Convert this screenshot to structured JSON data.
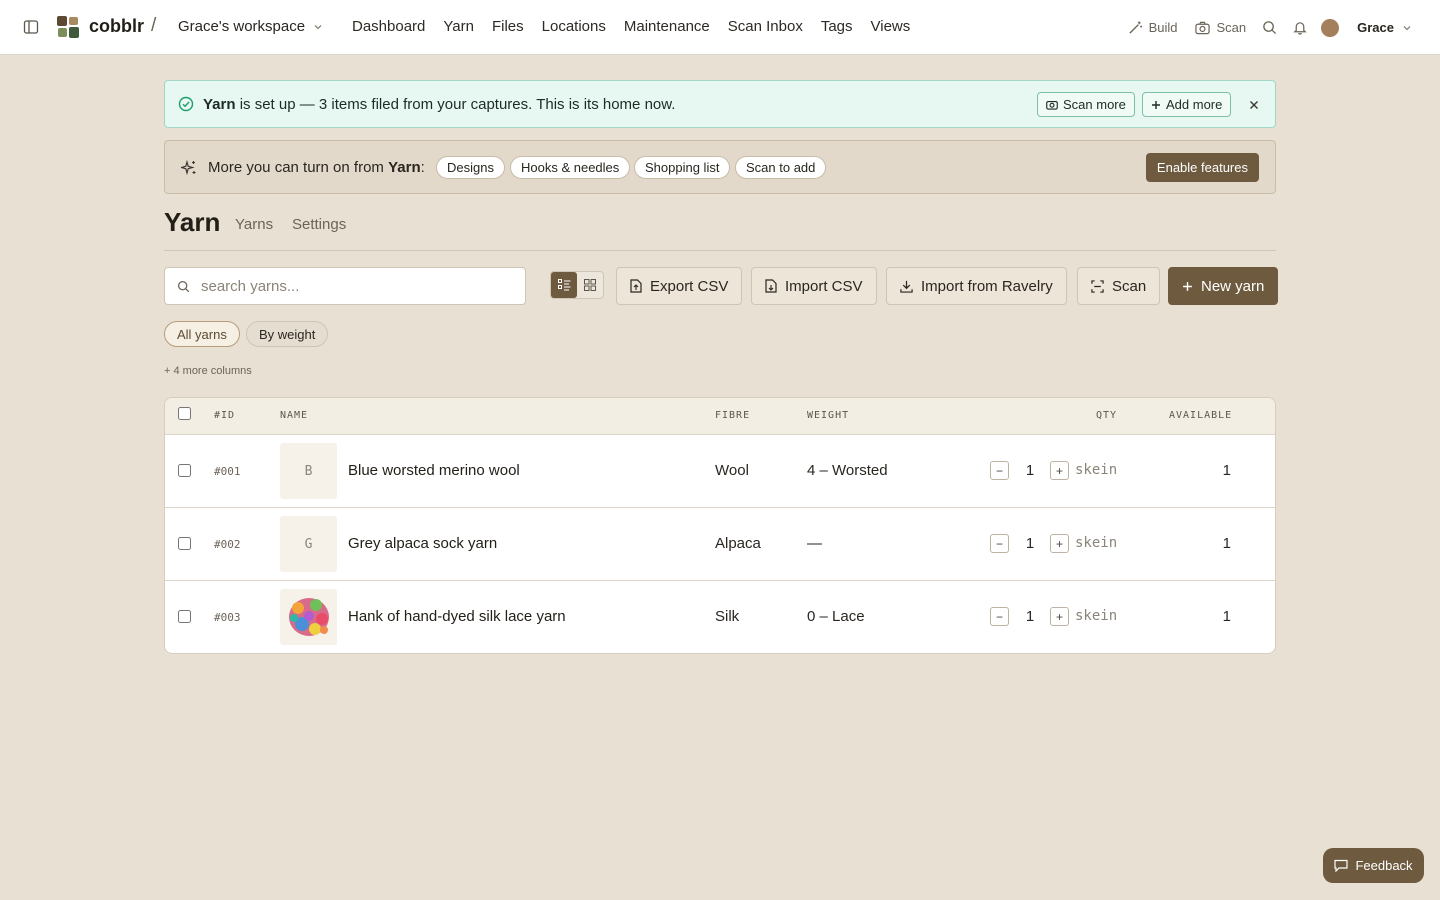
{
  "app": {
    "brand": "cobblr",
    "separator": "/",
    "workspace": "Grace's workspace"
  },
  "nav": [
    "Dashboard",
    "Yarn",
    "Files",
    "Locations",
    "Maintenance",
    "Scan Inbox",
    "Tags",
    "Views"
  ],
  "topbar": {
    "build_label": "Build",
    "scan_label": "Scan",
    "user_name": "Grace"
  },
  "success_banner": {
    "strong": "Yarn",
    "text": " is set up — 3 items filed from your captures. This is its home now.",
    "scan_more": "Scan more",
    "add_more": "Add more"
  },
  "features_banner": {
    "prefix": "More you can turn on from ",
    "strong": "Yarn",
    "suffix": ":",
    "chips": [
      "Designs",
      "Hooks & needles",
      "Shopping list",
      "Scan to add"
    ],
    "enable": "Enable features"
  },
  "page": {
    "title": "Yarn",
    "tabs": [
      "Yarns",
      "Settings"
    ]
  },
  "toolbar": {
    "search_placeholder": "search yarns...",
    "export_csv": "Export CSV",
    "import_csv": "Import CSV",
    "import_ravelry": "Import from Ravelry",
    "scan": "Scan",
    "new_yarn": "New yarn"
  },
  "filters": {
    "all": "All yarns",
    "by_weight": "By weight",
    "more_columns": "+ 4 more columns"
  },
  "table": {
    "headers": {
      "id": "#ID",
      "name": "NAME",
      "fibre": "FIBRE",
      "weight": "WEIGHT",
      "qty": "QTY",
      "available": "AVAILABLE"
    },
    "rows": [
      {
        "id": "#001",
        "thumb": "B",
        "name": "Blue worsted merino wool",
        "fibre": "Wool",
        "weight": "4 – Worsted",
        "qty": "1",
        "unit": "skein",
        "available": "1"
      },
      {
        "id": "#002",
        "thumb": "G",
        "name": "Grey alpaca sock yarn",
        "fibre": "Alpaca",
        "weight": "—",
        "qty": "1",
        "unit": "skein",
        "available": "1"
      },
      {
        "id": "#003",
        "thumb": "",
        "name": "Hank of hand-dyed silk lace yarn",
        "fibre": "Silk",
        "weight": "0 – Lace",
        "qty": "1",
        "unit": "skein",
        "available": "1"
      }
    ]
  },
  "feedback": "Feedback",
  "colors": {
    "accent": "#6e5a3f",
    "background": "#e8e0d2",
    "success_bg": "#e6f8f1",
    "success_icon": "#1f9d6c"
  }
}
